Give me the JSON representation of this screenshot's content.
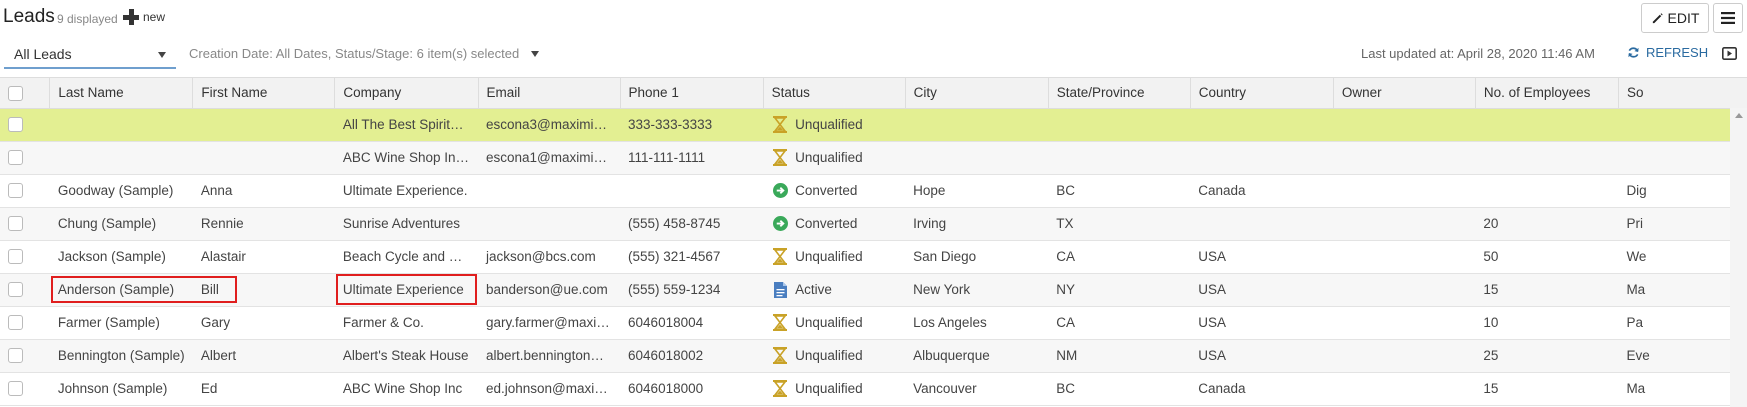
{
  "header": {
    "title": "Leads",
    "displayed": "9 displayed",
    "new_label": "new",
    "edit_label": "EDIT"
  },
  "filters": {
    "view": "All Leads",
    "criteria": "Creation Date: All Dates, Status/Stage: 6 item(s) selected",
    "last_updated": "Last updated at: April 28, 2020 11:46 AM",
    "refresh_label": "REFRESH"
  },
  "columns": [
    "Last Name",
    "First Name",
    "Company",
    "Email",
    "Phone 1",
    "Status",
    "City",
    "State/Province",
    "Country",
    "Owner",
    "No. of Employees",
    "So"
  ],
  "rows": [
    {
      "last": "",
      "first": "",
      "company": "All The Best Spirits …",
      "email": "escona3@maximiz…",
      "phone": "333-333-3333",
      "status": "Unqualified",
      "status_icon": "hourglass-icon",
      "city": "",
      "state": "",
      "country": "",
      "owner": "",
      "employees": "",
      "source": ""
    },
    {
      "last": "",
      "first": "",
      "company": "ABC Wine Shop Inc.…",
      "email": "escona1@maximiz…",
      "phone": "111-111-1111",
      "status": "Unqualified",
      "status_icon": "hourglass-icon",
      "city": "",
      "state": "",
      "country": "",
      "owner": "",
      "employees": "",
      "source": ""
    },
    {
      "last": "Goodway (Sample)",
      "first": "Anna",
      "company": "Ultimate Experience.",
      "email": "",
      "phone": "",
      "status": "Converted",
      "status_icon": "arrow-right-circle-icon",
      "city": "Hope",
      "state": "BC",
      "country": "Canada",
      "owner": "",
      "employees": "",
      "source": "Dig"
    },
    {
      "last": "Chung (Sample)",
      "first": "Rennie",
      "company": "Sunrise Adventures",
      "email": "",
      "phone": "(555) 458-8745",
      "status": "Converted",
      "status_icon": "arrow-right-circle-icon",
      "city": "Irving",
      "state": "TX",
      "country": "",
      "owner": "",
      "employees": "20",
      "source": "Pri"
    },
    {
      "last": "Jackson (Sample)",
      "first": "Alastair",
      "company": "Beach Cycle and Sp…",
      "email": "jackson@bcs.com",
      "phone": "(555) 321-4567",
      "status": "Unqualified",
      "status_icon": "hourglass-icon",
      "city": "San Diego",
      "state": "CA",
      "country": "USA",
      "owner": "",
      "employees": "50",
      "source": "We"
    },
    {
      "last": "Anderson (Sample)",
      "first": "Bill",
      "company": "Ultimate Experience",
      "email": "banderson@ue.com",
      "phone": "(555) 559-1234",
      "status": "Active",
      "status_icon": "document-icon",
      "city": "New York",
      "state": "NY",
      "country": "USA",
      "owner": "",
      "employees": "15",
      "source": "Ma"
    },
    {
      "last": "Farmer (Sample)",
      "first": "Gary",
      "company": "Farmer & Co.",
      "email": "gary.farmer@maxi…",
      "phone": "6046018004",
      "status": "Unqualified",
      "status_icon": "hourglass-icon",
      "city": "Los Angeles",
      "state": "CA",
      "country": "USA",
      "owner": "",
      "employees": "10",
      "source": "Pa"
    },
    {
      "last": "Bennington (Sample)",
      "first": "Albert",
      "company": "Albert's Steak House",
      "email": "albert.bennington@…",
      "phone": "6046018002",
      "status": "Unqualified",
      "status_icon": "hourglass-icon",
      "city": "Albuquerque",
      "state": "NM",
      "country": "USA",
      "owner": "",
      "employees": "25",
      "source": "Eve"
    },
    {
      "last": "Johnson (Sample)",
      "first": "Ed",
      "company": "ABC Wine Shop Inc",
      "email": "ed.johnson@maxim…",
      "phone": "6046018000",
      "status": "Unqualified",
      "status_icon": "hourglass-icon",
      "city": "Vancouver",
      "state": "BC",
      "country": "Canada",
      "owner": "",
      "employees": "15",
      "source": "Ma"
    }
  ],
  "colors": {
    "highlight_row": "#e3ef92",
    "accent_link": "#2a6aa0",
    "annotation_box": "#e01e1e"
  }
}
